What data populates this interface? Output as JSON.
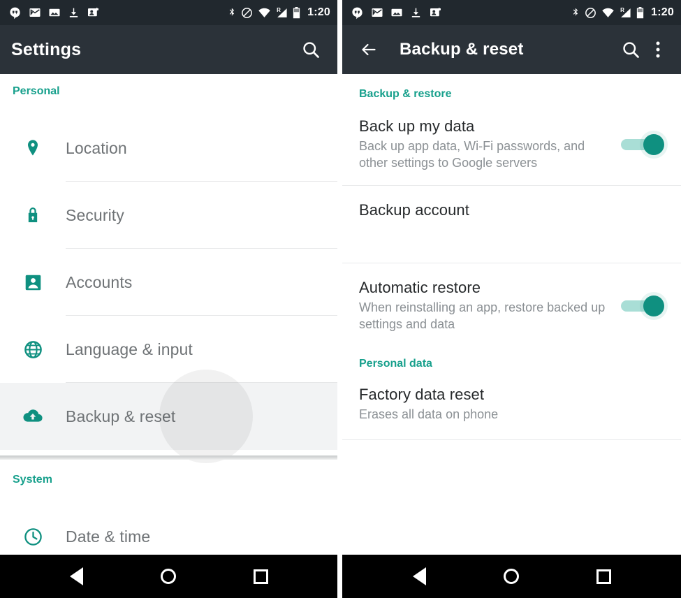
{
  "colors": {
    "accent_teal": "#17a08c",
    "icon_teal": "#0f9080",
    "toolbar_bg": "#2b3239",
    "statusbar_bg": "#21282e",
    "navbar_bg": "#000000",
    "switch_thumb_on": "#0f9080",
    "switch_track_on": "#a9ded6",
    "label_gray": "#6f7376",
    "subtitle_gray": "#8b9094"
  },
  "statusbar": {
    "time": "1:20",
    "notification_icons": [
      "hangouts-icon",
      "gmail-icon",
      "screenshot-icon",
      "download-icon",
      "contact-photo-icon"
    ],
    "system_icons": [
      "bluetooth-icon",
      "do-not-disturb-icon",
      "wifi-icon",
      "cellular-signal-roaming-icon",
      "battery-icon"
    ],
    "roaming_badge": "R"
  },
  "left_screen": {
    "toolbar": {
      "title": "Settings",
      "search_icon": "search-icon"
    },
    "sections": [
      {
        "header": "Personal",
        "items": [
          {
            "label": "Location",
            "icon": "location-pin-icon",
            "highlighted": false
          },
          {
            "label": "Security",
            "icon": "lock-icon",
            "highlighted": false
          },
          {
            "label": "Accounts",
            "icon": "account-box-icon",
            "highlighted": false
          },
          {
            "label": "Language & input",
            "icon": "globe-icon",
            "highlighted": false
          },
          {
            "label": "Backup & reset",
            "icon": "cloud-upload-icon",
            "highlighted": true
          }
        ]
      },
      {
        "header": "System",
        "items": [
          {
            "label": "Date & time",
            "icon": "clock-icon",
            "highlighted": false
          }
        ]
      }
    ]
  },
  "right_screen": {
    "toolbar": {
      "back_icon": "back-arrow-icon",
      "title": "Backup & reset",
      "search_icon": "search-icon",
      "overflow_icon": "overflow-menu-icon"
    },
    "sections": [
      {
        "header": "Backup & restore",
        "items": [
          {
            "title": "Back up my data",
            "subtitle": "Back up app data, Wi-Fi passwords, and other settings to Google servers",
            "has_switch": true,
            "switch_on": true,
            "redacted": false
          },
          {
            "title": "Backup account",
            "subtitle": "",
            "has_switch": false,
            "switch_on": false,
            "redacted": true
          },
          {
            "title": "Automatic restore",
            "subtitle": "When reinstalling an app, restore backed up settings and data",
            "has_switch": true,
            "switch_on": true,
            "redacted": false
          }
        ]
      },
      {
        "header": "Personal data",
        "items": [
          {
            "title": "Factory data reset",
            "subtitle": "Erases all data on phone",
            "has_switch": false,
            "switch_on": false,
            "redacted": false
          }
        ]
      }
    ]
  },
  "navbar": {
    "back_label": "Back",
    "home_label": "Home",
    "recents_label": "Recents"
  }
}
